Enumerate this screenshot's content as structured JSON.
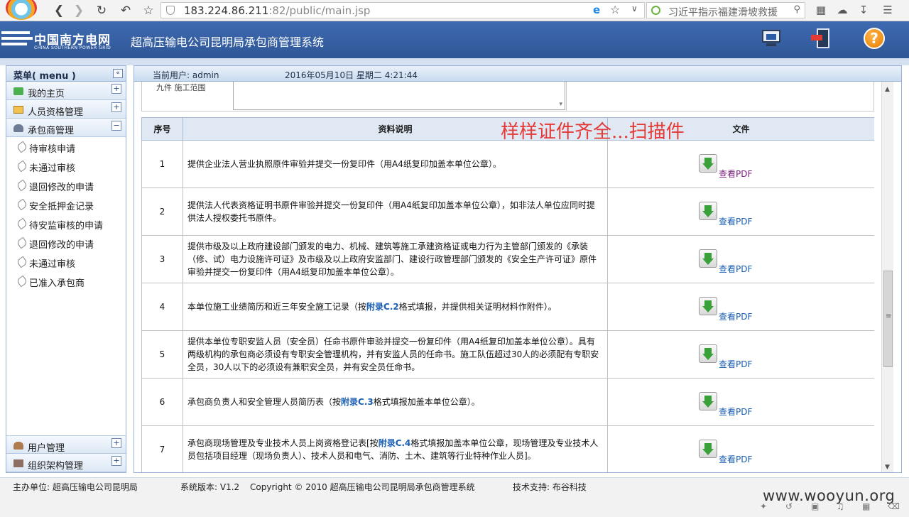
{
  "browser": {
    "url_host": "183.224.86.211",
    "url_rest": ":82/public/main.jsp",
    "search_text": "习近平指示福建滑坡救援"
  },
  "header": {
    "logo_cn": "中国南方电网",
    "logo_en": "CHINA SOUTHERN POWER GRID",
    "title": "超高压输电公司昆明局承包商管理系统"
  },
  "sidebar": {
    "title": "菜单( menu )",
    "collapse_symbol": "«",
    "sections_top": [
      {
        "label": "我的主页",
        "toggle": "+"
      },
      {
        "label": "人员资格管理",
        "toggle": "+"
      },
      {
        "label": "承包商管理",
        "toggle": "−"
      }
    ],
    "subitems": [
      {
        "label": "待审核申请"
      },
      {
        "label": "未通过审核"
      },
      {
        "label": "退回修改的申请"
      },
      {
        "label": "安全抵押金记录"
      },
      {
        "label": "待安监审核的申请"
      },
      {
        "label": "退回修改的申请"
      },
      {
        "label": "未通过审核"
      },
      {
        "label": "已准入承包商"
      }
    ],
    "sections_bottom": [
      {
        "label": "用户管理",
        "toggle": "+"
      },
      {
        "label": "组织架构管理",
        "toggle": "+"
      }
    ]
  },
  "main": {
    "current_user": "当前用户: admin",
    "datetime": "2016年05月10日 星期二 4:21:44",
    "upper_label": "九件 施工范围",
    "annotation": "样样证件齐全...扫描件",
    "table": {
      "headers": {
        "num": "序号",
        "desc": "资料说明",
        "file": "文件"
      },
      "link_label": "查看PDF",
      "rows": [
        {
          "num": "1",
          "desc": "提供企业法人营业执照原件审验并提交一份复印件（用A4纸复印加盖本单位公章）。",
          "visited": true
        },
        {
          "num": "2",
          "desc": "提供法人代表资格证明书原件审验并提交一份复印件（用A4纸复印加盖本单位公章），如非法人单位应同时提供法人授权委托书原件。",
          "visited": false
        },
        {
          "num": "3",
          "desc": "提供市级及以上政府建设部门颁发的电力、机械、建筑等施工承建资格证或电力行为主管部门颁发的《承装（修、试）电力设施许可证》及市级及以上政府安监部门、建设行政管理部门颁发的《安全生产许可证》原件审验并提交一份复印件（用A4纸复印加盖本单位公章）。",
          "visited": false
        },
        {
          "num": "4",
          "desc_pre": "本单位施工业绩简历和近三年安全施工记录（按",
          "desc_link": "附录C.2",
          "desc_post": "格式填报，并提供相关证明材料作附件）。",
          "visited": false
        },
        {
          "num": "5",
          "desc": "提供本单位专职安监人员（安全员）任命书原件审验并提交一份复印件（用A4纸复印加盖本单位公章）。具有两级机构的承包商必须设有专职安全管理机构，并有安监人员的任命书。施工队伍超过30人的必须配有专职安全员，30人以下的必须设有兼职安全员，并有安全员任命书。",
          "visited": false
        },
        {
          "num": "6",
          "desc_pre": "承包商负责人和安全管理人员简历表（按",
          "desc_link": "附录C.3",
          "desc_post": "格式填报加盖本单位公章）。",
          "visited": false
        },
        {
          "num": "7",
          "desc_pre": "承包商现场管理及专业技术人员上岗资格登记表[按",
          "desc_link": "附录C.4",
          "desc_post": "格式填报加盖本单位公章，现场管理及专业技术人员包括项目经理（现场负责人）、技术人员和电气、消防、土木、建筑等行业特种作业人员]。",
          "visited": false
        }
      ]
    }
  },
  "footer": {
    "sponsor": "主办单位: 超高压输电公司昆明局",
    "version": "系统版本: V1.2",
    "copyright": "Copyright © 2010 超高压输电公司昆明局承包商管理系统",
    "support": "技术支持: 布谷科技"
  },
  "watermark": "www.wooyun.org"
}
